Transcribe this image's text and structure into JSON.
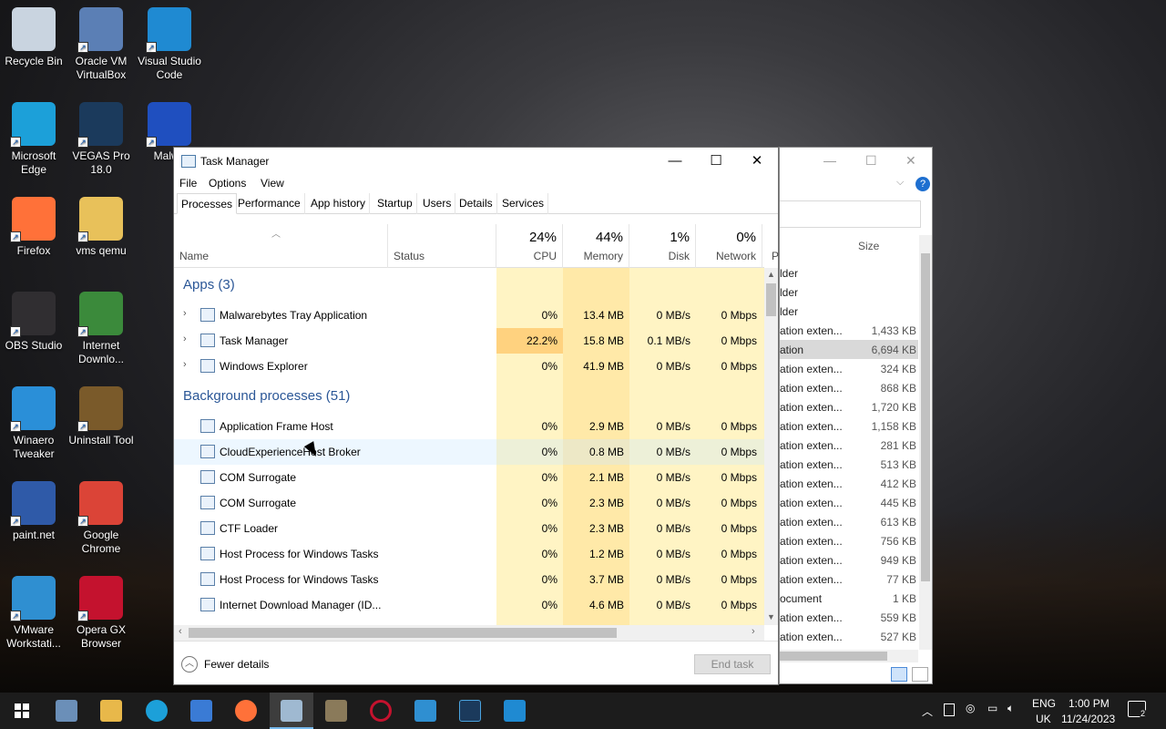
{
  "desktop": {
    "icons": [
      {
        "label": "Recycle Bin",
        "name": "recycle-bin-icon",
        "color": "#c9d4e0"
      },
      {
        "label": "Oracle VM VirtualBox",
        "name": "virtualbox-icon",
        "color": "#5b7fb5"
      },
      {
        "label": "Visual Studio Code",
        "name": "vscode-icon",
        "color": "#1f8ad2"
      },
      {
        "label": "Microsoft Edge",
        "name": "edge-icon",
        "color": "#1ca0d9"
      },
      {
        "label": "VEGAS Pro 18.0",
        "name": "vegas-pro-icon",
        "color": "#1b3a5c"
      },
      {
        "label": "Malwa",
        "name": "malwarebytes-icon",
        "color": "#1f4fbf"
      },
      {
        "label": "Firefox",
        "name": "firefox-icon",
        "color": "#ff7139"
      },
      {
        "label": "vms qemu",
        "name": "folder-icon",
        "color": "#e8c15a"
      },
      {
        "label": "OBS Studio",
        "name": "obs-icon",
        "color": "#302e31"
      },
      {
        "label": "Internet Downlo...",
        "name": "idm-icon",
        "color": "#3b8a3b"
      },
      {
        "label": "Winaero Tweaker",
        "name": "winaero-icon",
        "color": "#2a8fd8"
      },
      {
        "label": "Uninstall Tool",
        "name": "uninstall-tool-icon",
        "color": "#7a5a2a"
      },
      {
        "label": "paint.net",
        "name": "paintnet-icon",
        "color": "#2f5aa8"
      },
      {
        "label": "Google Chrome",
        "name": "chrome-icon",
        "color": "#db4437"
      },
      {
        "label": "VMware Workstati...",
        "name": "vmware-icon",
        "color": "#2f8fd1"
      },
      {
        "label": "Opera GX Browser",
        "name": "opera-gx-icon",
        "color": "#c4122e"
      }
    ]
  },
  "explorer_bg": {
    "size_header": "Size",
    "rows": [
      {
        "type": "lder",
        "size": ""
      },
      {
        "type": "lder",
        "size": ""
      },
      {
        "type": "lder",
        "size": ""
      },
      {
        "type": "ation exten...",
        "size": "1,433 KB"
      },
      {
        "type": "ation",
        "size": "6,694 KB"
      },
      {
        "type": "ation exten...",
        "size": "324 KB"
      },
      {
        "type": "ation exten...",
        "size": "868 KB"
      },
      {
        "type": "ation exten...",
        "size": "1,720 KB"
      },
      {
        "type": "ation exten...",
        "size": "1,158 KB"
      },
      {
        "type": "ation exten...",
        "size": "281 KB"
      },
      {
        "type": "ation exten...",
        "size": "513 KB"
      },
      {
        "type": "ation exten...",
        "size": "412 KB"
      },
      {
        "type": "ation exten...",
        "size": "445 KB"
      },
      {
        "type": "ation exten...",
        "size": "613 KB"
      },
      {
        "type": "ation exten...",
        "size": "756 KB"
      },
      {
        "type": "ation exten...",
        "size": "949 KB"
      },
      {
        "type": "ation exten...",
        "size": "77 KB"
      },
      {
        "type": "ocument",
        "size": "1 KB"
      },
      {
        "type": "ation exten...",
        "size": "559 KB"
      },
      {
        "type": "ation exten...",
        "size": "527 KB"
      }
    ]
  },
  "taskmgr": {
    "title": "Task Manager",
    "menu": [
      "File",
      "Options",
      "View"
    ],
    "tabs": [
      "Processes",
      "Performance",
      "App history",
      "Startup",
      "Users",
      "Details",
      "Services"
    ],
    "columns": {
      "name": "Name",
      "status": "Status",
      "cpu": {
        "pct": "24%",
        "label": "CPU"
      },
      "memory": {
        "pct": "44%",
        "label": "Memory"
      },
      "disk": {
        "pct": "1%",
        "label": "Disk"
      },
      "network": {
        "pct": "0%",
        "label": "Network"
      },
      "extra": "P"
    },
    "apps_header": "Apps (3)",
    "apps": [
      {
        "name": "Malwarebytes Tray Application",
        "icon": "malwarebytes-icon",
        "cpu": "0%",
        "memory": "13.4 MB",
        "disk": "0 MB/s",
        "network": "0 Mbps"
      },
      {
        "name": "Task Manager",
        "icon": "task-manager-icon",
        "cpu": "22.2%",
        "memory": "15.8 MB",
        "disk": "0.1 MB/s",
        "network": "0 Mbps"
      },
      {
        "name": "Windows Explorer",
        "icon": "explorer-icon",
        "cpu": "0%",
        "memory": "41.9 MB",
        "disk": "0 MB/s",
        "network": "0 Mbps"
      }
    ],
    "bg_header": "Background processes (51)",
    "background": [
      {
        "name": "Application Frame Host",
        "icon": "app-window-icon",
        "cpu": "0%",
        "memory": "2.9 MB",
        "disk": "0 MB/s",
        "network": "0 Mbps"
      },
      {
        "name": "CloudExperienceHost Broker",
        "icon": "app-window-icon",
        "cpu": "0%",
        "memory": "0.8 MB",
        "disk": "0 MB/s",
        "network": "0 Mbps"
      },
      {
        "name": "COM Surrogate",
        "icon": "app-window-icon",
        "cpu": "0%",
        "memory": "2.1 MB",
        "disk": "0 MB/s",
        "network": "0 Mbps"
      },
      {
        "name": "COM Surrogate",
        "icon": "app-window-icon",
        "cpu": "0%",
        "memory": "2.3 MB",
        "disk": "0 MB/s",
        "network": "0 Mbps"
      },
      {
        "name": "CTF Loader",
        "icon": "ctf-loader-icon",
        "cpu": "0%",
        "memory": "2.3 MB",
        "disk": "0 MB/s",
        "network": "0 Mbps"
      },
      {
        "name": "Host Process for Windows Tasks",
        "icon": "app-window-icon",
        "cpu": "0%",
        "memory": "1.2 MB",
        "disk": "0 MB/s",
        "network": "0 Mbps"
      },
      {
        "name": "Host Process for Windows Tasks",
        "icon": "app-window-icon",
        "cpu": "0%",
        "memory": "3.7 MB",
        "disk": "0 MB/s",
        "network": "0 Mbps"
      },
      {
        "name": "Internet Download Manager (ID...",
        "icon": "idm-icon",
        "cpu": "0%",
        "memory": "4.6 MB",
        "disk": "0 MB/s",
        "network": "0 Mbps"
      }
    ],
    "fewer_details": "Fewer details",
    "end_task": "End task",
    "colors": {
      "heat_light": "#fff4c4",
      "heat_mid": "#ffe9a8",
      "heat_high": "#ffd27f",
      "section": "#2b5797"
    }
  },
  "taskbar": {
    "lang_top": "ENG",
    "lang_bottom": "UK",
    "time": "1:00 PM",
    "date": "11/24/2023",
    "notif_count": "2"
  }
}
